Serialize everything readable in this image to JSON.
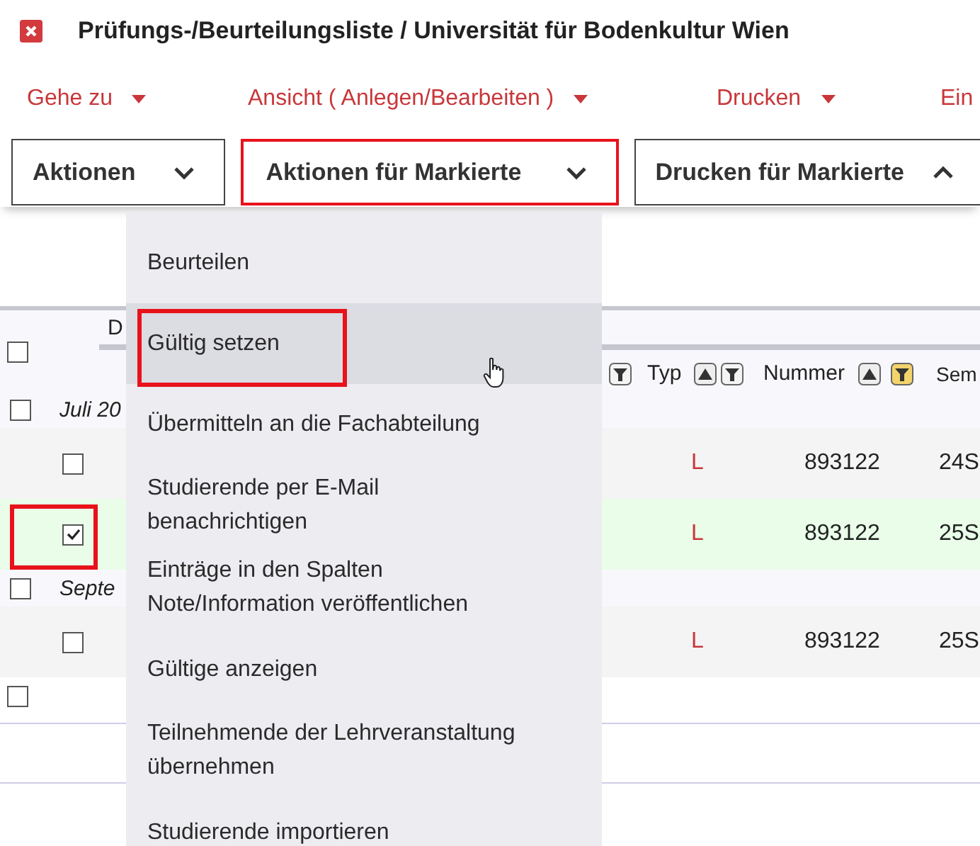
{
  "title": "Prüfungs-/Beurteilungsliste / Universität für Bodenkultur Wien",
  "menubar": [
    {
      "label": "Gehe zu",
      "caret": true
    },
    {
      "label": "Ansicht ( Anlegen/Bearbeiten )",
      "caret": true
    },
    {
      "label": "Drucken",
      "caret": true
    },
    {
      "label": "Ein"
    }
  ],
  "toolbar": [
    {
      "label": "Aktionen",
      "expanded": false,
      "highlighted": false
    },
    {
      "label": "Aktionen für Markierte",
      "expanded": false,
      "highlighted": true
    },
    {
      "label": "Drucken für Markierte",
      "expanded": true,
      "highlighted": false
    }
  ],
  "table": {
    "header_checked": false,
    "columns": [
      {
        "label": "D"
      },
      {
        "icons": [
          {
            "kind": "filter",
            "active": false
          }
        ]
      },
      {
        "label": "Typ",
        "icons": [
          {
            "kind": "sort"
          },
          {
            "kind": "filter",
            "active": false
          }
        ]
      },
      {
        "label": "Nummer",
        "icons": [
          {
            "kind": "sort"
          },
          {
            "kind": "filter",
            "active": true
          }
        ]
      },
      {
        "label": "Sem"
      }
    ],
    "rows": [
      {
        "kind": "group",
        "label": "Juli 20",
        "checked": false
      },
      {
        "kind": "item",
        "checked": false,
        "highlighted": false,
        "type": "L",
        "number": "893122",
        "semester": "24S"
      },
      {
        "kind": "item",
        "checked": true,
        "highlighted": true,
        "type": "L",
        "number": "893122",
        "semester": "25S"
      },
      {
        "kind": "group",
        "label": "Septe",
        "checked": false
      },
      {
        "kind": "item",
        "checked": false,
        "highlighted": false,
        "type": "L",
        "number": "893122",
        "semester": "25S"
      },
      {
        "kind": "empty",
        "checked": false
      }
    ]
  },
  "dropdown": [
    {
      "label": "Beurteilen",
      "hovered": false,
      "highlighted": false
    },
    {
      "label": "Gültig setzen",
      "hovered": true,
      "highlighted": true
    },
    {
      "label": "Übermitteln an die Fachabteilung",
      "hovered": false,
      "highlighted": false
    },
    {
      "label": "Studierende per E-Mail benachrichtigen",
      "hovered": false,
      "highlighted": false
    },
    {
      "label": "Einträge in den Spalten Note/Information veröffentlichen",
      "hovered": false,
      "highlighted": false
    },
    {
      "label": "Gültige anzeigen",
      "hovered": false,
      "highlighted": false
    },
    {
      "label": "Teilnehmende der Lehrveranstaltung übernehmen",
      "hovered": false,
      "highlighted": false
    },
    {
      "label": "Studierende importieren",
      "hovered": false,
      "highlighted": false
    }
  ]
}
